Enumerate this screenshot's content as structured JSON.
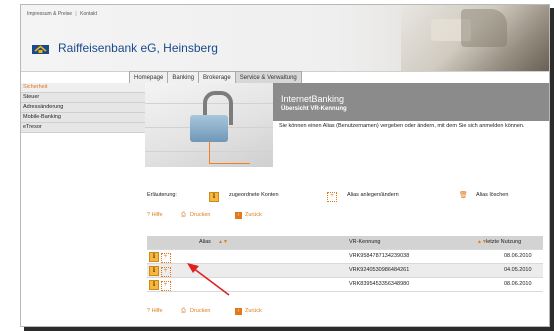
{
  "header": {
    "top_links": [
      "Impressum & Preise",
      "Kontakt"
    ],
    "bank_name": "Raiffeisenbank eG, Heinsberg"
  },
  "tabs": [
    "Homepage",
    "Banking",
    "Brokerage",
    "Service & Verwaltung"
  ],
  "active_tab": "Service & Verwaltung",
  "sidebar": {
    "items": [
      "Sicherheit",
      "Steuer",
      "Adressänderung",
      "Mobile-Banking",
      "eTresor"
    ],
    "active": "Sicherheit"
  },
  "banner": {
    "title": "InternetBanking",
    "subtitle": "Übersicht VR-Kennung"
  },
  "description": "Sie können einen Alias (Benutzernamen) vergeben oder ändern, mit dem Sie sich anmelden können.",
  "legend": {
    "label": "Erläuterung:",
    "info": "zugeordnete Konten",
    "alias": "Alias anlegen/ändern",
    "delete": "Alias löschen"
  },
  "actions": {
    "help": "? Hilfe",
    "print": "Drucken",
    "back": "Zurück"
  },
  "table": {
    "headers": [
      "Alias",
      "VR-Kennung",
      "letzte Nutzung"
    ],
    "rows": [
      {
        "alias": "",
        "vr": "VRK9584787134239038",
        "date": "08.06.2010"
      },
      {
        "alias": "",
        "vr": "VRK9240530986484261",
        "date": "04.05.2010"
      },
      {
        "alias": "",
        "vr": "VRK8395453356348980",
        "date": "08.06.2010"
      }
    ]
  },
  "colors": {
    "accent": "#e07b18",
    "brand_blue": "#1a4a8a",
    "banner_gray": "#8b8b8b",
    "annotation_red": "#e02020"
  }
}
